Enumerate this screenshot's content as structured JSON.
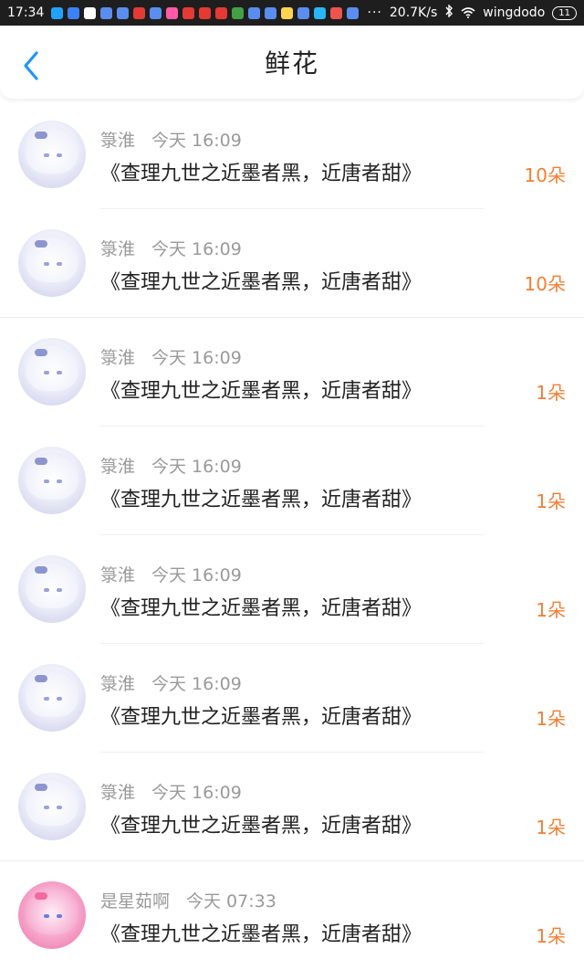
{
  "status_bar": {
    "time": "17:34",
    "network_speed": "20.7K/s",
    "wifi_name": "wingdodo",
    "battery": "11",
    "notification_icon_colors": [
      "#1fa3ff",
      "#3b82f6",
      "#ffffff",
      "#5b8def",
      "#5b8def",
      "#e53935",
      "#5b8def",
      "#ff5aa5",
      "#e53935",
      "#e53935",
      "#e53935",
      "#43a047",
      "#5b8def",
      "#5b8def",
      "#ffd54f",
      "#5b8def",
      "#29b6f6",
      "#ef5350",
      "#5b8def"
    ]
  },
  "header": {
    "title": "鲜花"
  },
  "colors": {
    "accent": "#2196f3",
    "amount": "#f07f36",
    "meta": "#9a9a9a"
  },
  "items": [
    {
      "user": "箓淮",
      "time": "今天 16:09",
      "content": "《查理九世之近墨者黑，近唐者甜》",
      "amount": "10朵",
      "avatar": "anime-girl-white"
    },
    {
      "user": "箓淮",
      "time": "今天 16:09",
      "content": "《查理九世之近墨者黑，近唐者甜》",
      "amount": "10朵",
      "avatar": "anime-girl-white"
    },
    {
      "user": "箓淮",
      "time": "今天 16:09",
      "content": "《查理九世之近墨者黑，近唐者甜》",
      "amount": "1朵",
      "avatar": "anime-girl-white"
    },
    {
      "user": "箓淮",
      "time": "今天 16:09",
      "content": "《查理九世之近墨者黑，近唐者甜》",
      "amount": "1朵",
      "avatar": "anime-girl-white"
    },
    {
      "user": "箓淮",
      "time": "今天 16:09",
      "content": "《查理九世之近墨者黑，近唐者甜》",
      "amount": "1朵",
      "avatar": "anime-girl-white"
    },
    {
      "user": "箓淮",
      "time": "今天 16:09",
      "content": "《查理九世之近墨者黑，近唐者甜》",
      "amount": "1朵",
      "avatar": "anime-girl-white"
    },
    {
      "user": "箓淮",
      "time": "今天 16:09",
      "content": "《查理九世之近墨者黑，近唐者甜》",
      "amount": "1朵",
      "avatar": "anime-girl-white"
    },
    {
      "user": "是星茹啊",
      "time": "今天 07:33",
      "content": "《查理九世之近墨者黑，近唐者甜》",
      "amount": "1朵",
      "avatar": "anime-girl-pink"
    }
  ]
}
